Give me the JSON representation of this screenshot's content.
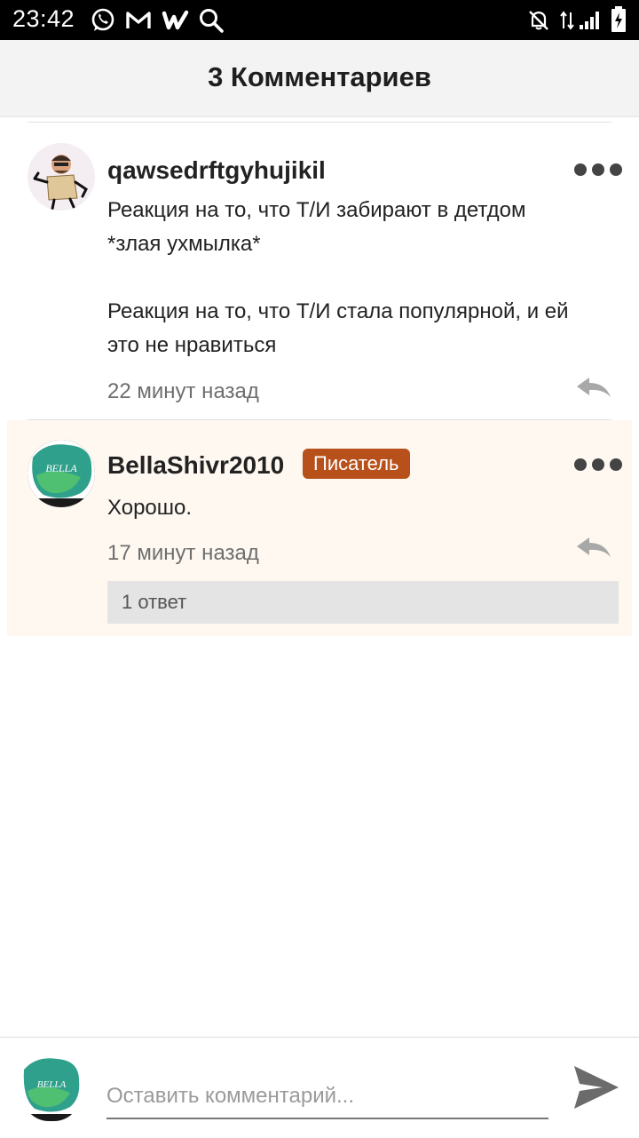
{
  "status_bar": {
    "time": "23:42"
  },
  "header": {
    "title": "3 Комментариев"
  },
  "comments": [
    {
      "username": "qawsedrftgyhujikil",
      "lines": [
        "Реакция на то, что Т/И забирают в детдом",
        "*злая ухмылка*",
        "",
        "Реакция на то, что Т/И стала популярной, и ей",
        "это не нравиться"
      ],
      "time": "22 минут назад"
    },
    {
      "username": "BellaShivr2010",
      "badge": "Писатель",
      "lines": [
        "Хорошо."
      ],
      "time": "17 минут назад",
      "replies": "1 ответ",
      "avatar_text": "BELLA"
    }
  ],
  "composer": {
    "placeholder": "Оставить комментарий...",
    "avatar_text": "BELLA"
  },
  "colors": {
    "badge": "#b8501c",
    "highlight": "#fef8f1",
    "header_bg": "#f3f3f3"
  }
}
